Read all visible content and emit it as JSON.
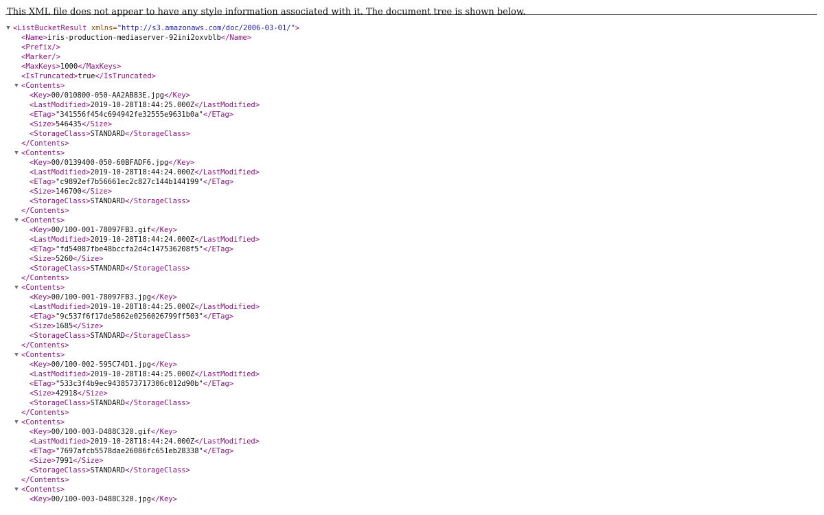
{
  "notice": "This XML file does not appear to have any style information associated with it. The document tree is shown below.",
  "root": {
    "open_tag": "<ListBucketResult",
    "attr_name": "xmlns=",
    "attr_value": "\"http://s3.amazonaws.com/doc/2006-03-01/\"",
    "open_tag_end": ">",
    "toggle_glyph": "▼"
  },
  "header_fields": {
    "name_open": "<Name>",
    "name_value": "iris-production-mediaserver-92ini2oxvblb",
    "name_close": "</Name>",
    "prefix": "<Prefix/>",
    "marker": "<Marker/>",
    "maxkeys_open": "<MaxKeys>",
    "maxkeys_value": "1000",
    "maxkeys_close": "</MaxKeys>",
    "truncated_open": "<IsTruncated>",
    "truncated_value": "true",
    "truncated_close": "</IsTruncated>"
  },
  "tags": {
    "contents_open": "<Contents>",
    "contents_close": "</Contents>",
    "key_open": "<Key>",
    "key_close": "</Key>",
    "lastmod_open": "<LastModified>",
    "lastmod_close": "</LastModified>",
    "etag_open": "<ETag>",
    "etag_close": "</ETag>",
    "size_open": "<Size>",
    "size_close": "</Size>",
    "storage_open": "<StorageClass>",
    "storage_close": "</StorageClass>"
  },
  "contents": [
    {
      "key": "00/010800-050-AA2AB83E.jpg",
      "last_modified": "2019-10-28T18:44:25.000Z",
      "etag": "\"341556f454c694942fe32555e9631b0a\"",
      "size": "546435",
      "storage_class": "STANDARD"
    },
    {
      "key": "00/0139400-050-60BFADF6.jpg",
      "last_modified": "2019-10-28T18:44:24.000Z",
      "etag": "\"c9892ef7b56661ec2c827c144b144199\"",
      "size": "146700",
      "storage_class": "STANDARD"
    },
    {
      "key": "00/100-001-78097FB3.gif",
      "last_modified": "2019-10-28T18:44:24.000Z",
      "etag": "\"fd54087fbe48bccfa2d4c147536208f5\"",
      "size": "5260",
      "storage_class": "STANDARD"
    },
    {
      "key": "00/100-001-78097FB3.jpg",
      "last_modified": "2019-10-28T18:44:25.000Z",
      "etag": "\"9c537f6f17de5862e0256026799ff503\"",
      "size": "1685",
      "storage_class": "STANDARD"
    },
    {
      "key": "00/100-002-595C74D1.jpg",
      "last_modified": "2019-10-28T18:44:25.000Z",
      "etag": "\"533c3f4b9ec9438573717306c012d90b\"",
      "size": "42918",
      "storage_class": "STANDARD"
    },
    {
      "key": "00/100-003-D488C320.gif",
      "last_modified": "2019-10-28T18:44:24.000Z",
      "etag": "\"7697afcb5578dae26086fc651eb28338\"",
      "size": "7991",
      "storage_class": "STANDARD"
    }
  ],
  "partial_entry": {
    "key": "00/100-003-D488C320.jpg"
  },
  "colors": {
    "tag": "#881280",
    "attribute_name": "#994500",
    "attribute_value": "#1a1aa6",
    "text": "#111111"
  }
}
